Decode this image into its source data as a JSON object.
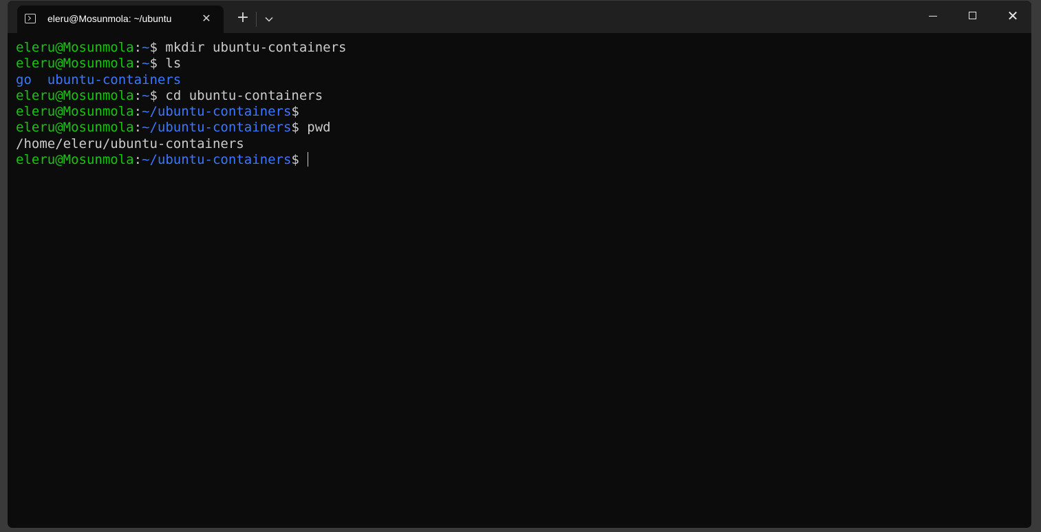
{
  "window": {
    "tab_title": "eleru@Mosunmola: ~/ubuntu",
    "tab_close": "✕",
    "new_tab": "+",
    "dropdown": "⌄",
    "close": "✕"
  },
  "colors": {
    "user": "#16c60c",
    "path": "#3b78ff",
    "text": "#cccccc",
    "background": "#0c0c0c"
  },
  "icons": [
    "terminal-icon",
    "close-icon",
    "plus-icon",
    "chevron-down-icon",
    "minimize-icon",
    "maximize-icon"
  ],
  "terminal": {
    "lines": [
      {
        "user": "eleru@Mosunmola",
        "sep": ":",
        "path": "~",
        "prompt": "$",
        "cmd": " mkdir ubuntu-containers"
      },
      {
        "user": "eleru@Mosunmola",
        "sep": ":",
        "path": "~",
        "prompt": "$",
        "cmd": " ls"
      },
      {
        "output": "go  ubuntu-containers"
      },
      {
        "user": "eleru@Mosunmola",
        "sep": ":",
        "path": "~",
        "prompt": "$",
        "cmd": " cd ubuntu-containers"
      },
      {
        "user": "eleru@Mosunmola",
        "sep": ":",
        "path": "~/ubuntu-containers",
        "prompt": "$",
        "cmd": ""
      },
      {
        "user": "eleru@Mosunmola",
        "sep": ":",
        "path": "~/ubuntu-containers",
        "prompt": "$",
        "cmd": " pwd"
      },
      {
        "output": "/home/eleru/ubuntu-containers"
      },
      {
        "user": "eleru@Mosunmola",
        "sep": ":",
        "path": "~/ubuntu-containers",
        "prompt": "$",
        "cmd": ""
      }
    ]
  }
}
